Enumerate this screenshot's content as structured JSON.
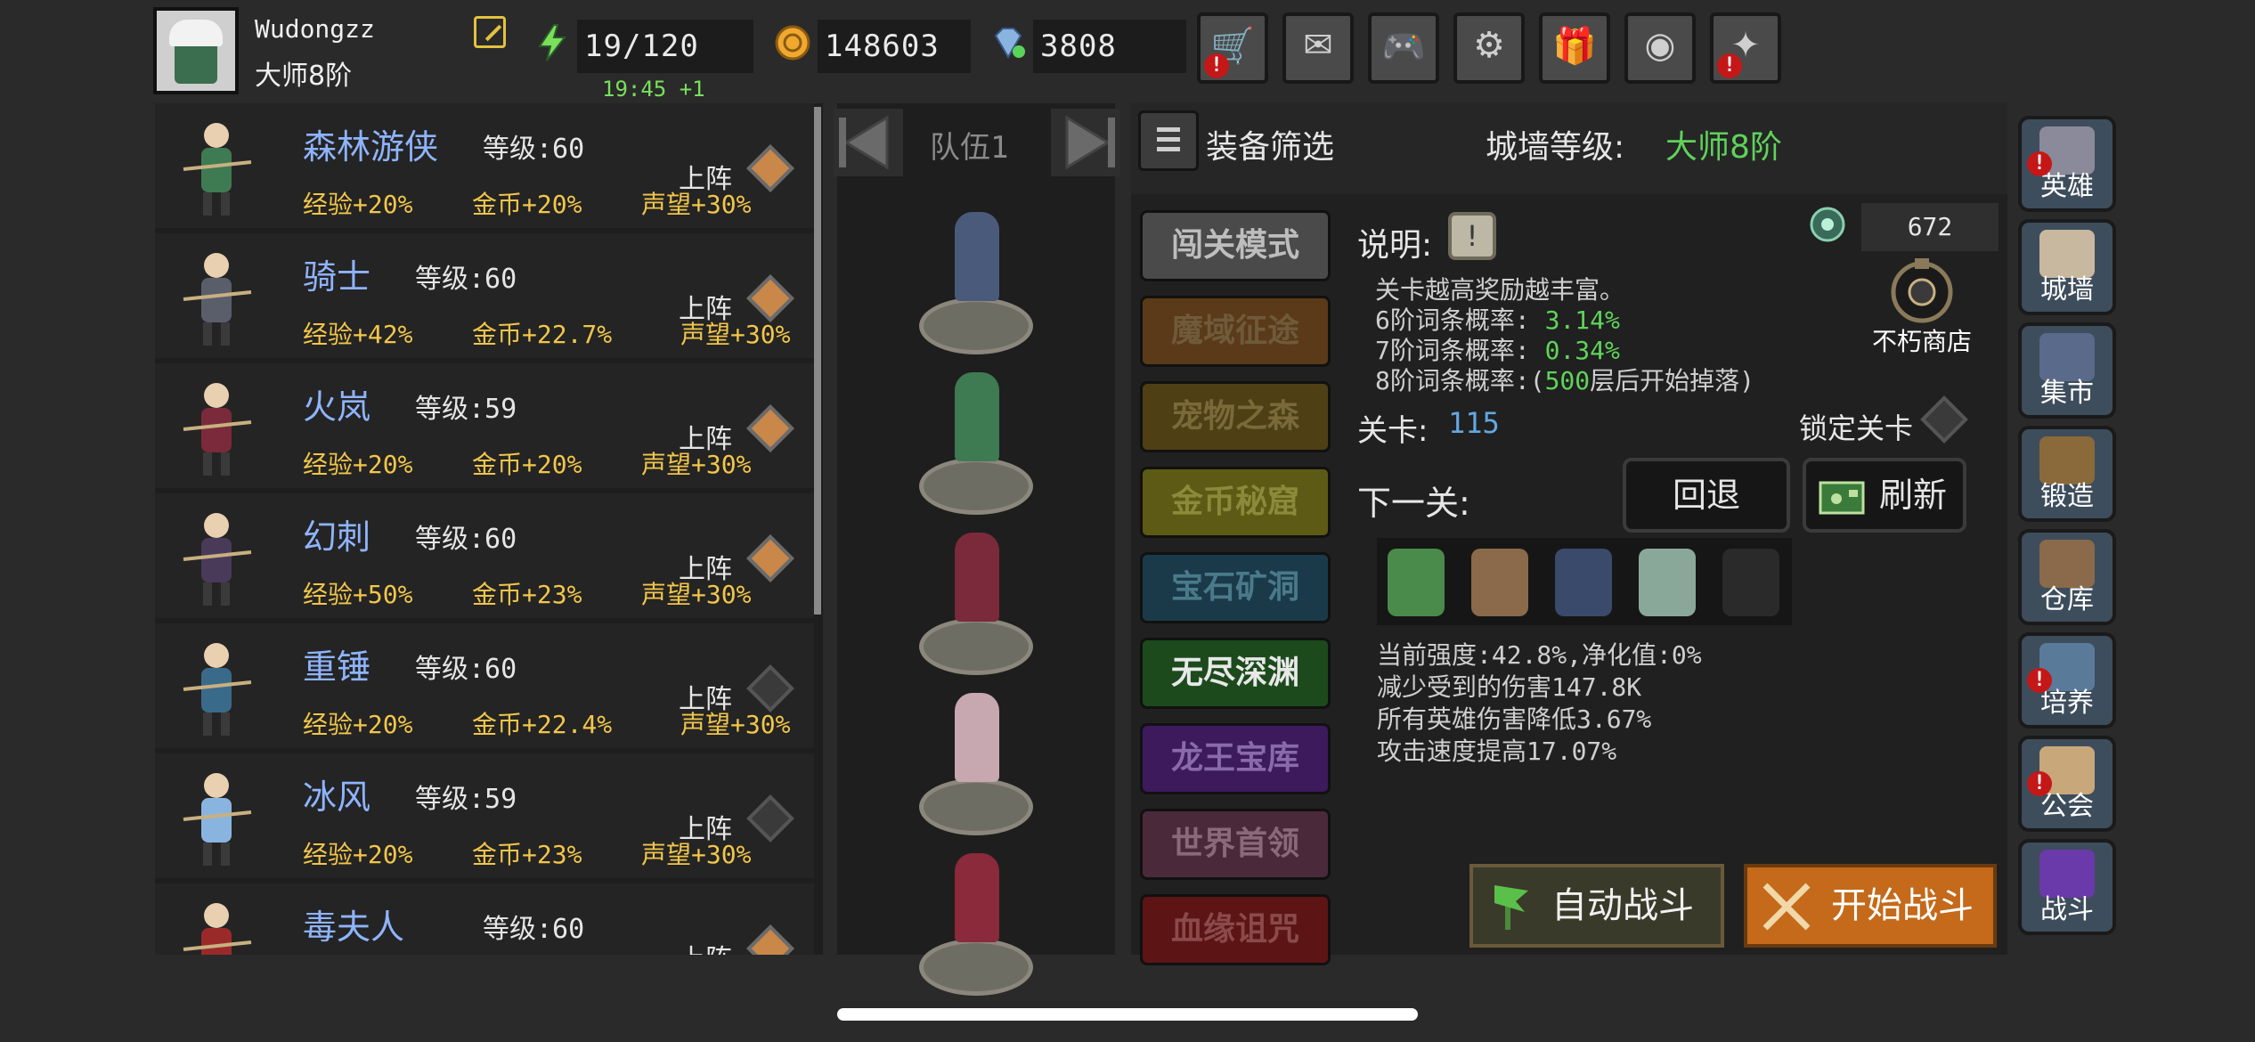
{
  "player": {
    "name": "Wudongzz",
    "rank": "大师8阶"
  },
  "resources": {
    "energy": "19/120",
    "energy_timer": "19:45 +1",
    "gold": "148603",
    "gems": "3808"
  },
  "top_buttons": [
    {
      "icon": "cart-icon",
      "glyph": "🛒",
      "alert": true
    },
    {
      "icon": "mail-icon",
      "glyph": "✉",
      "alert": false
    },
    {
      "icon": "gamepad-icon",
      "glyph": "🎮",
      "alert": false
    },
    {
      "icon": "gear-icon",
      "glyph": "⚙",
      "alert": false
    },
    {
      "icon": "gift-icon",
      "glyph": "🎁",
      "alert": false
    },
    {
      "icon": "color-wheel-icon",
      "glyph": "◉",
      "alert": false
    },
    {
      "icon": "firework-icon",
      "glyph": "✦",
      "alert": true
    }
  ],
  "heroes": [
    {
      "name": "森林游侠",
      "level": "等级:60",
      "exp": "经验+20%",
      "gold": "金币+20%",
      "fame": "声望+30%",
      "deploy": "上阵",
      "deployed": true,
      "color": "#3e7a52"
    },
    {
      "name": "骑士",
      "level": "等级:60",
      "exp": "经验+42%",
      "gold": "金币+22.7%",
      "fame": "声望+30%",
      "deploy": "上阵",
      "deployed": true,
      "color": "#5a5e6a"
    },
    {
      "name": "火岚",
      "level": "等级:59",
      "exp": "经验+20%",
      "gold": "金币+20%",
      "fame": "声望+30%",
      "deploy": "上阵",
      "deployed": true,
      "color": "#7a2a3a"
    },
    {
      "name": "幻刺",
      "level": "等级:60",
      "exp": "经验+50%",
      "gold": "金币+23%",
      "fame": "声望+30%",
      "deploy": "上阵",
      "deployed": true,
      "color": "#4a3a5a"
    },
    {
      "name": "重锤",
      "level": "等级:60",
      "exp": "经验+20%",
      "gold": "金币+22.4%",
      "fame": "声望+30%",
      "deploy": "上阵",
      "deployed": false,
      "color": "#3a6a8a"
    },
    {
      "name": "冰风",
      "level": "等级:59",
      "exp": "经验+20%",
      "gold": "金币+23%",
      "fame": "声望+30%",
      "deploy": "上阵",
      "deployed": false,
      "color": "#8ab4e0"
    },
    {
      "name": "毒夫人",
      "level": "等级:60",
      "exp": "",
      "gold": "",
      "fame": "",
      "deploy": "上阵",
      "deployed": true,
      "color": "#9a2a2a"
    }
  ],
  "team": {
    "name": "队伍1"
  },
  "filter": {
    "label": "装备筛选"
  },
  "wall": {
    "label": "城墙等级:",
    "value": "大师8阶"
  },
  "modes": [
    {
      "label": "闯关模式",
      "bg": "#4a4a4a",
      "fg": "#bdbdbd"
    },
    {
      "label": "魔域征途",
      "bg": "#5a3a18",
      "fg": "#6f5a3a"
    },
    {
      "label": "宠物之森",
      "bg": "#4f3f14",
      "fg": "#7a6a3a"
    },
    {
      "label": "金币秘窟",
      "bg": "#5c5a14",
      "fg": "#8a8a3a"
    },
    {
      "label": "宝石矿洞",
      "bg": "#1a3a4a",
      "fg": "#4a7a8a"
    },
    {
      "label": "无尽深渊",
      "bg": "#1c4a1c",
      "fg": "#e8e8e8"
    },
    {
      "label": "龙王宝库",
      "bg": "#3c1a5c",
      "fg": "#8a6aaa"
    },
    {
      "label": "世界首领",
      "bg": "#4a2a3a",
      "fg": "#8a6a7a"
    },
    {
      "label": "血缘诅咒",
      "bg": "#5c1414",
      "fg": "#8a4a4a"
    }
  ],
  "description": {
    "title": "说明:",
    "line1": "关卡越高奖励越丰富。",
    "line2_prefix": "6阶词条概率:",
    "line2_value": "3.14%",
    "line3_prefix": "7阶词条概率:",
    "line3_value": "0.34%",
    "line4_prefix": "8阶词条概率:(",
    "line4_value": "500",
    "line4_suffix": "层后开始掉落)"
  },
  "shop": {
    "currency": "672",
    "label": "不朽商店"
  },
  "stage": {
    "label": "关卡:",
    "value": "115",
    "lock_label": "锁定关卡"
  },
  "next": {
    "label": "下一关:",
    "back": "回退",
    "refresh": "刷新"
  },
  "enemies": [
    "medusa",
    "minotaur",
    "dark-knight",
    "serpent",
    "panther"
  ],
  "effects": [
    "当前强度:42.8%,净化值:0%",
    "减少受到的伤害147.8K",
    "所有英雄伤害降低3.67%",
    "攻击速度提高17.07%"
  ],
  "actions": {
    "auto": "自动战斗",
    "start": "开始战斗"
  },
  "side_nav": [
    {
      "label": "英雄",
      "alert": true,
      "color": "#8a8a9a"
    },
    {
      "label": "城墙",
      "alert": false,
      "color": "#c8b8a0"
    },
    {
      "label": "集市",
      "alert": false,
      "color": "#5a6a8a"
    },
    {
      "label": "锻造",
      "alert": false,
      "color": "#8a6a3a"
    },
    {
      "label": "仓库",
      "alert": false,
      "color": "#8a6a4a"
    },
    {
      "label": "培养",
      "alert": true,
      "color": "#5a7a9a"
    },
    {
      "label": "公会",
      "alert": true,
      "color": "#c8a87a"
    },
    {
      "label": "战斗",
      "alert": false,
      "color": "#6a3aaa"
    }
  ]
}
